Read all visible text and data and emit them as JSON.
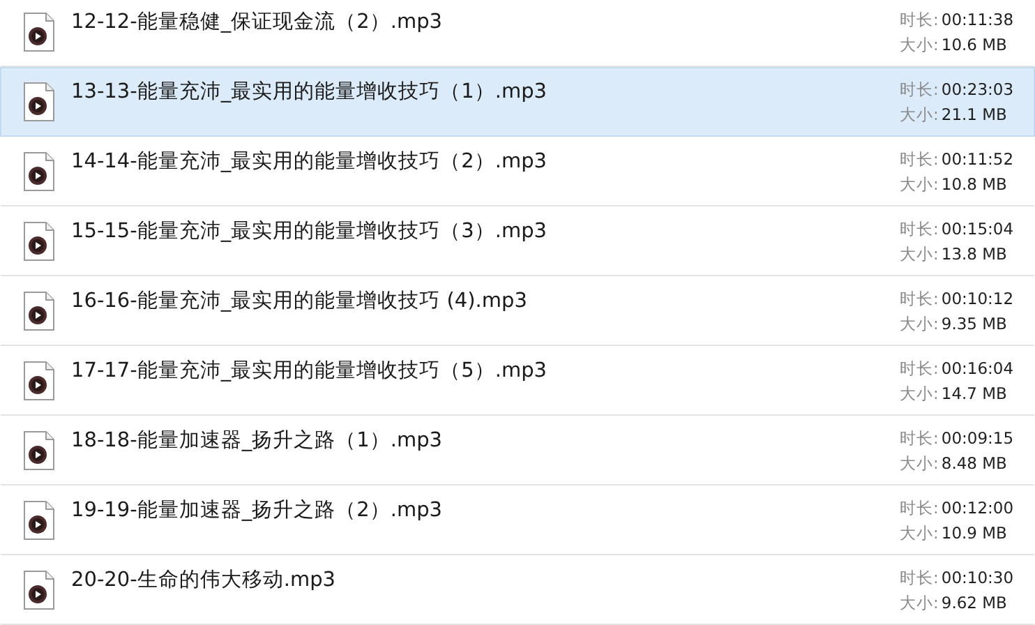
{
  "files": [
    {
      "name": "12-12-能量稳健_保证现金流（2）.mp3",
      "duration_label": "时长:",
      "duration": "00:11:38",
      "size_label": "大小:",
      "size": "10.6 MB",
      "selected": false
    },
    {
      "name": "13-13-能量充沛_最实用的能量增收技巧（1）.mp3",
      "duration_label": "时长:",
      "duration": "00:23:03",
      "size_label": "大小:",
      "size": "21.1 MB",
      "selected": true
    },
    {
      "name": "14-14-能量充沛_最实用的能量增收技巧（2）.mp3",
      "duration_label": "时长:",
      "duration": "00:11:52",
      "size_label": "大小:",
      "size": "10.8 MB",
      "selected": false
    },
    {
      "name": "15-15-能量充沛_最实用的能量增收技巧（3）.mp3",
      "duration_label": "时长:",
      "duration": "00:15:04",
      "size_label": "大小:",
      "size": "13.8 MB",
      "selected": false
    },
    {
      "name": "16-16-能量充沛_最实用的能量增收技巧 (4).mp3",
      "duration_label": "时长:",
      "duration": "00:10:12",
      "size_label": "大小:",
      "size": "9.35 MB",
      "selected": false
    },
    {
      "name": "17-17-能量充沛_最实用的能量增收技巧（5）.mp3",
      "duration_label": "时长:",
      "duration": "00:16:04",
      "size_label": "大小:",
      "size": "14.7 MB",
      "selected": false
    },
    {
      "name": "18-18-能量加速器_扬升之路（1）.mp3",
      "duration_label": "时长:",
      "duration": "00:09:15",
      "size_label": "大小:",
      "size": "8.48 MB",
      "selected": false
    },
    {
      "name": "19-19-能量加速器_扬升之路（2）.mp3",
      "duration_label": "时长:",
      "duration": "00:12:00",
      "size_label": "大小:",
      "size": "10.9 MB",
      "selected": false
    },
    {
      "name": "20-20-生命的伟大移动.mp3",
      "duration_label": "时长:",
      "duration": "00:10:30",
      "size_label": "大小:",
      "size": "9.62 MB",
      "selected": false
    }
  ]
}
